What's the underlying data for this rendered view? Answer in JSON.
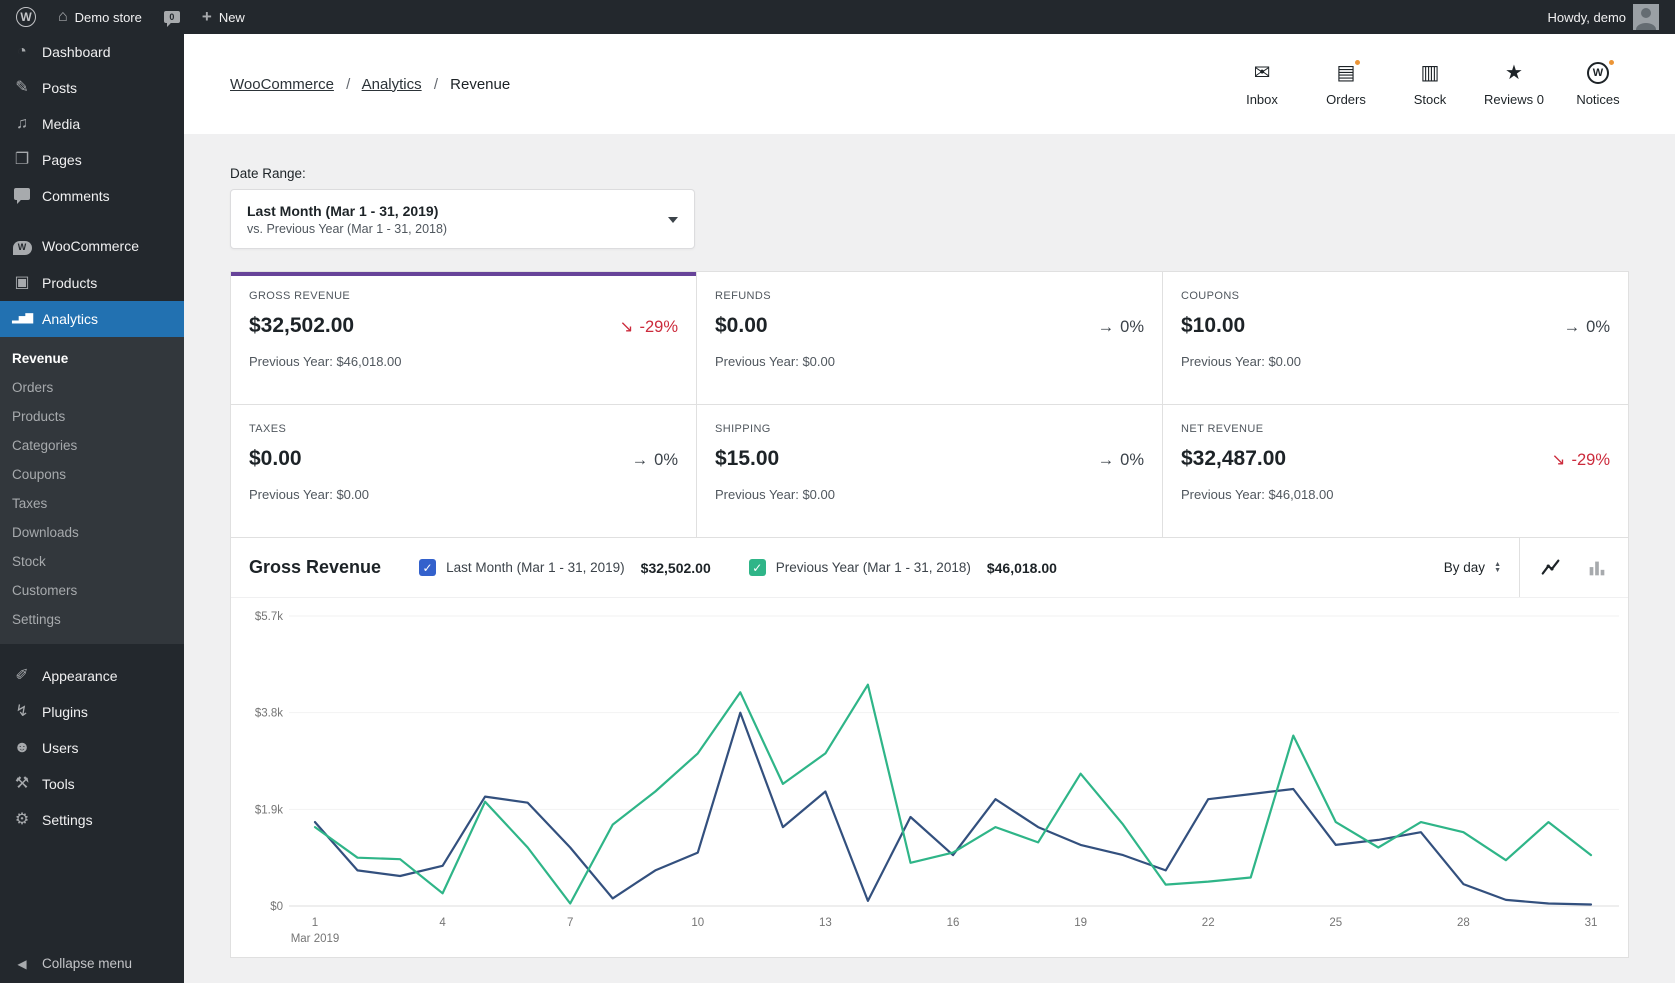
{
  "admin_bar": {
    "site_name": "Demo store",
    "comment_count": "0",
    "new_label": "New",
    "howdy": "Howdy, demo"
  },
  "sidebar": {
    "items": [
      {
        "label": "Dashboard",
        "icon": "dashboard-icon"
      },
      {
        "label": "Posts",
        "icon": "posts-icon"
      },
      {
        "label": "Media",
        "icon": "media-icon"
      },
      {
        "label": "Pages",
        "icon": "pages-icon"
      },
      {
        "label": "Comments",
        "icon": "comments-icon"
      },
      {
        "label": "WooCommerce",
        "icon": "woocommerce-icon"
      },
      {
        "label": "Products",
        "icon": "products-icon"
      },
      {
        "label": "Analytics",
        "icon": "analytics-icon",
        "active": true
      }
    ],
    "analytics_submenu": [
      {
        "label": "Revenue",
        "current": true
      },
      {
        "label": "Orders"
      },
      {
        "label": "Products"
      },
      {
        "label": "Categories"
      },
      {
        "label": "Coupons"
      },
      {
        "label": "Taxes"
      },
      {
        "label": "Downloads"
      },
      {
        "label": "Stock"
      },
      {
        "label": "Customers"
      },
      {
        "label": "Settings"
      }
    ],
    "lower_items": [
      {
        "label": "Appearance",
        "icon": "appearance-icon"
      },
      {
        "label": "Plugins",
        "icon": "plugins-icon"
      },
      {
        "label": "Users",
        "icon": "users-icon"
      },
      {
        "label": "Tools",
        "icon": "tools-icon"
      },
      {
        "label": "Settings",
        "icon": "settings-icon"
      }
    ],
    "collapse_label": "Collapse menu"
  },
  "header": {
    "breadcrumb": {
      "part1": "WooCommerce",
      "part2": "Analytics",
      "part3": "Revenue",
      "sep": "/"
    },
    "activity": [
      {
        "label": "Inbox",
        "icon": "inbox-icon",
        "dot": false
      },
      {
        "label": "Orders",
        "icon": "orders-icon",
        "dot": true
      },
      {
        "label": "Stock",
        "icon": "stock-icon",
        "dot": false
      },
      {
        "label": "Reviews 0",
        "icon": "reviews-star-icon",
        "dot": false
      },
      {
        "label": "Notices",
        "icon": "notices-icon",
        "dot": true
      }
    ]
  },
  "filters": {
    "date_range_label": "Date Range:",
    "range_primary": "Last Month (Mar 1 - 31, 2019)",
    "range_secondary": "vs. Previous Year (Mar 1 - 31, 2018)"
  },
  "tiles": [
    {
      "label": "GROSS REVENUE",
      "value": "$32,502.00",
      "trend_arrow": "↘",
      "trend": "-29%",
      "trend_dir": "down",
      "previous": "Previous Year: $46,018.00",
      "selected": true
    },
    {
      "label": "REFUNDS",
      "value": "$0.00",
      "trend_arrow": "→",
      "trend": "0%",
      "trend_dir": "flat",
      "previous": "Previous Year: $0.00"
    },
    {
      "label": "COUPONS",
      "value": "$10.00",
      "trend_arrow": "→",
      "trend": "0%",
      "trend_dir": "flat",
      "previous": "Previous Year: $0.00"
    },
    {
      "label": "TAXES",
      "value": "$0.00",
      "trend_arrow": "→",
      "trend": "0%",
      "trend_dir": "flat",
      "previous": "Previous Year: $0.00"
    },
    {
      "label": "SHIPPING",
      "value": "$15.00",
      "trend_arrow": "→",
      "trend": "0%",
      "trend_dir": "flat",
      "previous": "Previous Year: $0.00"
    },
    {
      "label": "NET REVENUE",
      "value": "$32,487.00",
      "trend_arrow": "↘",
      "trend": "-29%",
      "trend_dir": "down",
      "previous": "Previous Year: $46,018.00"
    }
  ],
  "chart_section": {
    "title": "Gross Revenue",
    "legend": [
      {
        "label": "Last Month (Mar 1 - 31, 2019)",
        "total": "$32,502.00",
        "checked": true,
        "color": "#33507e"
      },
      {
        "label": "Previous Year (Mar 1 - 31, 2018)",
        "total": "$46,018.00",
        "checked": true,
        "color": "#2fb588"
      }
    ],
    "interval_label": "By day"
  },
  "chart_data": {
    "type": "line",
    "title": "Gross Revenue",
    "interval": "By day",
    "x": [
      1,
      2,
      3,
      4,
      5,
      6,
      7,
      8,
      9,
      10,
      11,
      12,
      13,
      14,
      15,
      16,
      17,
      18,
      19,
      20,
      21,
      22,
      23,
      24,
      25,
      26,
      27,
      28,
      29,
      30,
      31
    ],
    "x_tick_positions": [
      1,
      4,
      7,
      10,
      13,
      16,
      19,
      22,
      25,
      28,
      31
    ],
    "x_axis_secondary_label": "Mar 2019",
    "ylim": [
      0,
      5700
    ],
    "y_ticks": [
      0,
      1900,
      3800,
      5700
    ],
    "y_tick_labels": [
      "$0",
      "$1.9k",
      "$3.8k",
      "$5.7k"
    ],
    "grid": true,
    "legend_position": "top",
    "series": [
      {
        "name": "Last Month (Mar 1 - 31, 2019)",
        "color": "#33507e",
        "total": 32502.0,
        "values": [
          1650,
          700,
          590,
          790,
          2150,
          2030,
          1150,
          150,
          700,
          1050,
          3800,
          1550,
          2250,
          100,
          1750,
          1000,
          2100,
          1550,
          1200,
          1000,
          700,
          2100,
          2200,
          2300,
          1200,
          1300,
          1450,
          430,
          120,
          50,
          30
        ]
      },
      {
        "name": "Previous Year (Mar 1 - 31, 2018)",
        "color": "#2fb588",
        "total": 46018.0,
        "values": [
          1550,
          950,
          920,
          250,
          2050,
          1150,
          50,
          1600,
          2250,
          3000,
          4200,
          2400,
          3000,
          4350,
          850,
          1050,
          1550,
          1250,
          2600,
          1600,
          420,
          480,
          560,
          3350,
          1650,
          1150,
          1650,
          1450,
          900,
          1650,
          1000
        ]
      }
    ]
  },
  "colors": {
    "accent_purple": "#674399",
    "trend_negative": "#cc2b3c",
    "active_menu_blue": "#2271b1",
    "notice_dot": "#ec9536",
    "checkbox_blue": "#3361cc",
    "checkbox_green": "#2fb588"
  }
}
